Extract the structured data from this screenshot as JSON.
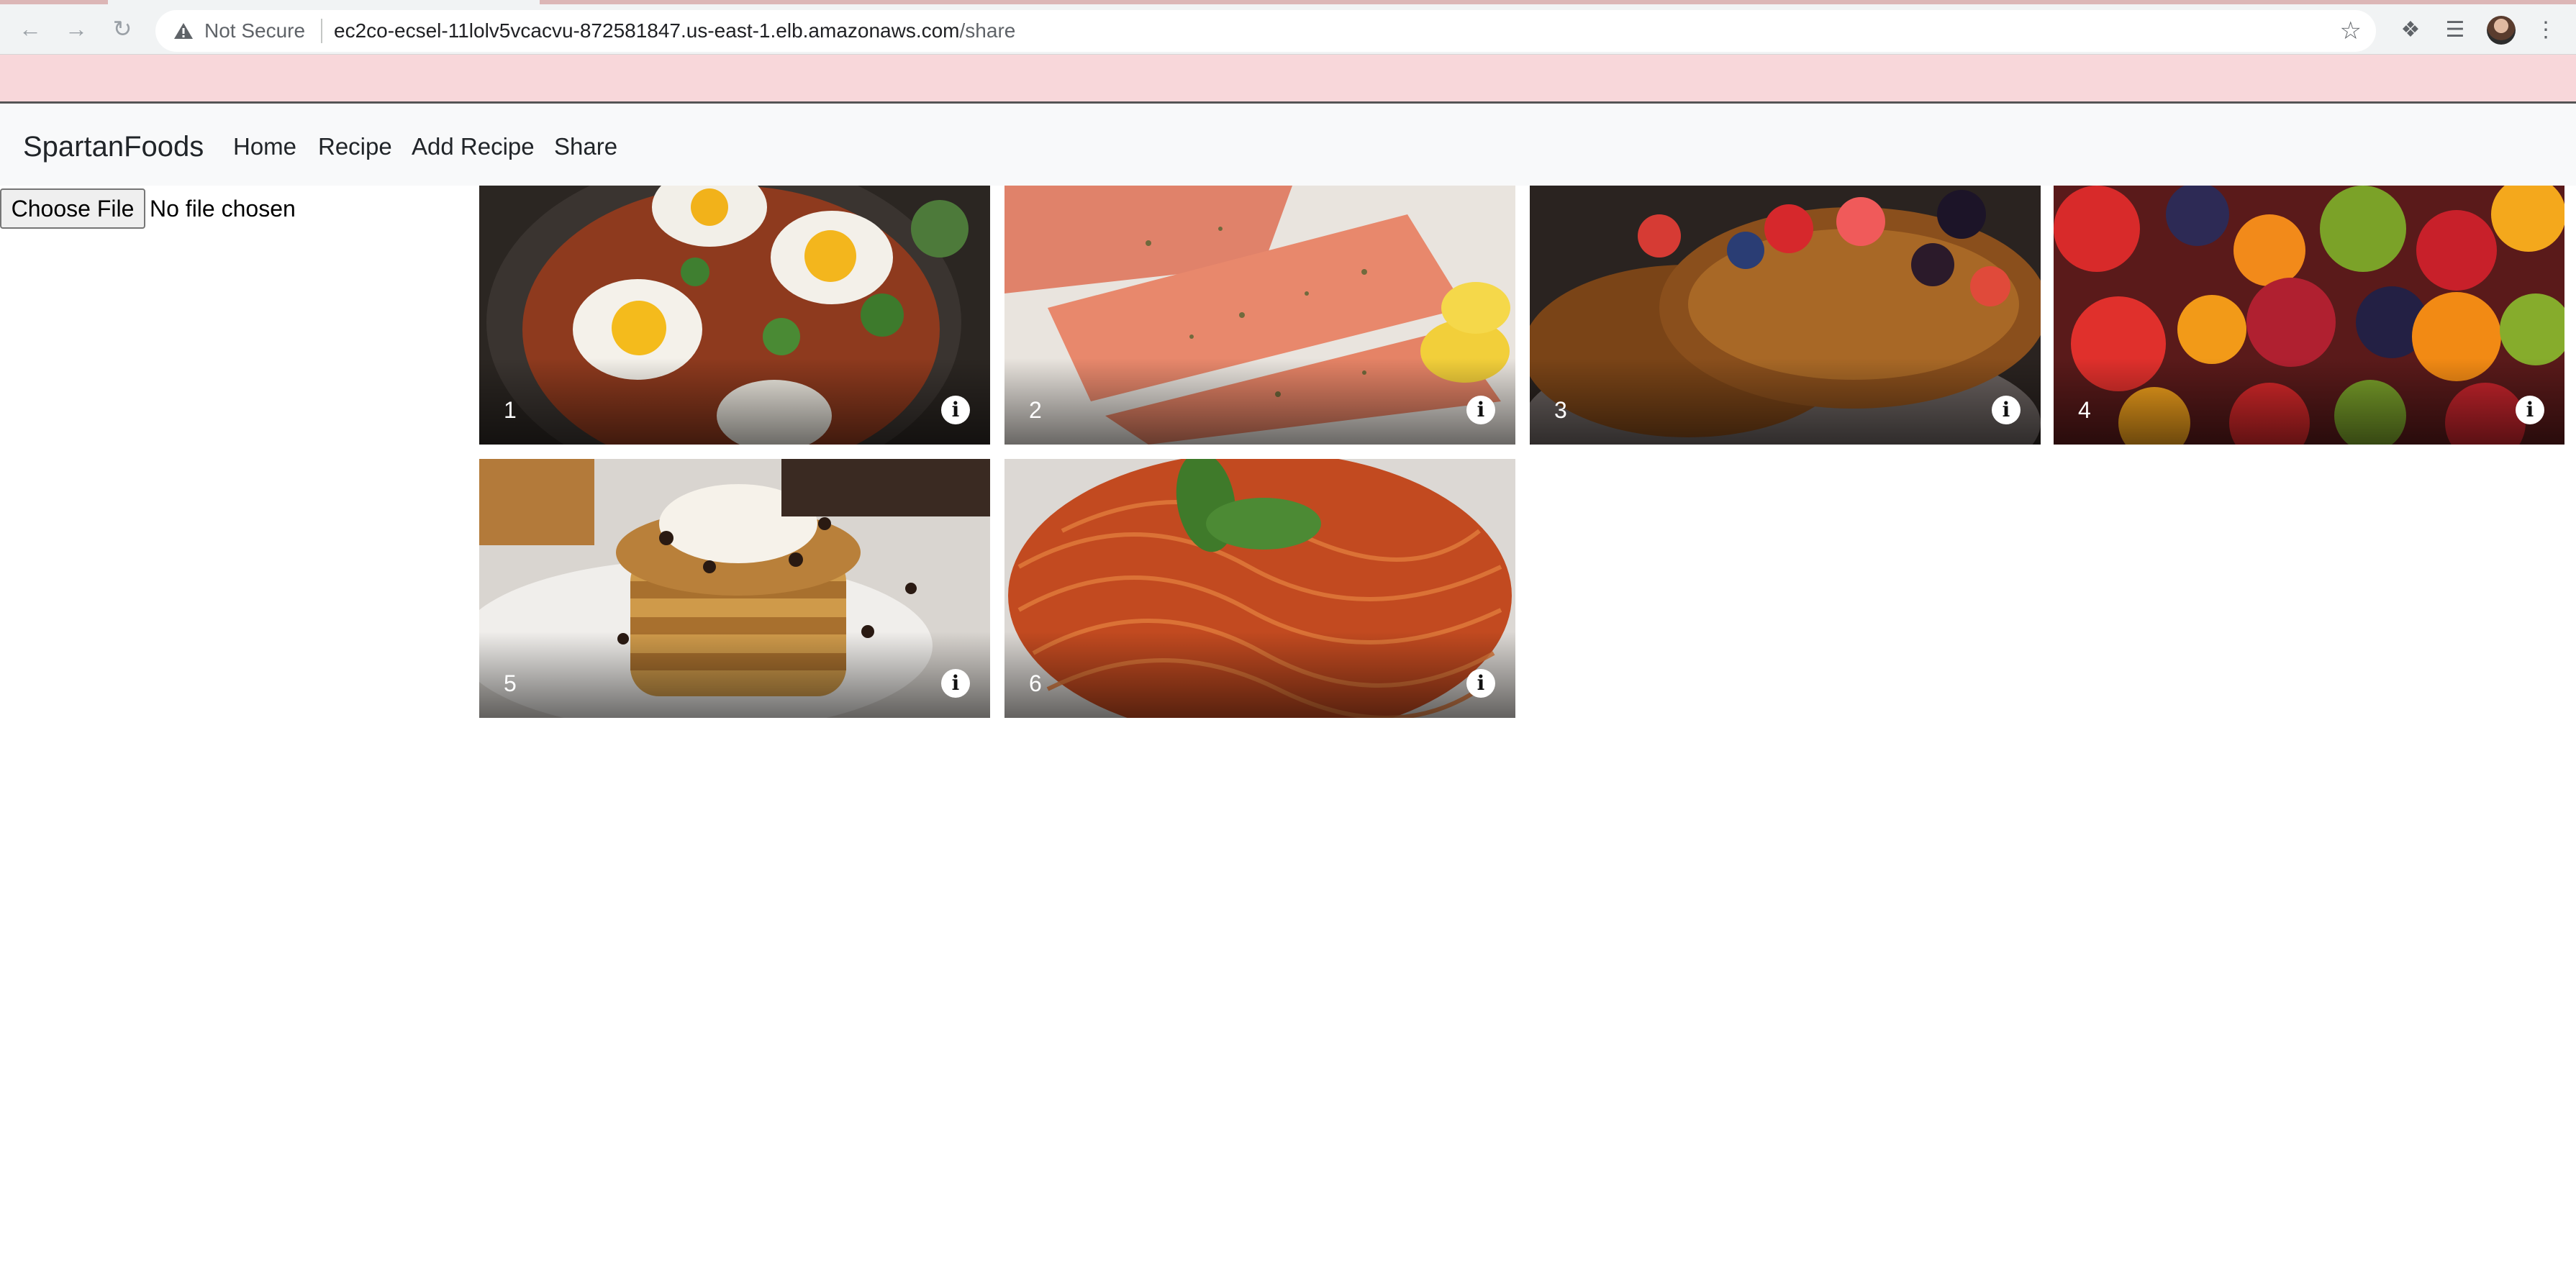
{
  "browser": {
    "security_label": "Not Secure",
    "url_host": "ec2co-ecsel-11lolv5vcacvu-872581847.us-east-1.elb.amazonaws.com",
    "url_path": "/share"
  },
  "navbar": {
    "brand": "SpartanFoods",
    "links": [
      "Home",
      "Recipe",
      "Add Recipe",
      "Share"
    ]
  },
  "upload": {
    "button_label": "Choose File",
    "status": "No file chosen"
  },
  "gallery": {
    "items": [
      {
        "number": "1",
        "subject": "shakshuka eggs skillet"
      },
      {
        "number": "2",
        "subject": "salmon fillets with lemon"
      },
      {
        "number": "3",
        "subject": "french toast with berries"
      },
      {
        "number": "4",
        "subject": "fruit salad"
      },
      {
        "number": "5",
        "subject": "pancake stack with chocolate chips"
      },
      {
        "number": "6",
        "subject": "spaghetti with basil"
      }
    ],
    "info_glyph": "i"
  },
  "colors": {
    "banner": "#f8d7da",
    "navbar": "#f8f9fa"
  }
}
